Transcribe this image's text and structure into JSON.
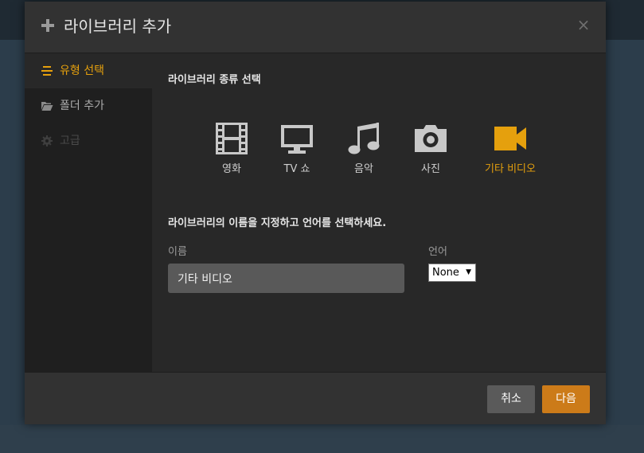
{
  "dialog": {
    "title": "라이브러리 추가",
    "close_symbol": "×"
  },
  "sidebar": {
    "items": [
      {
        "label": "유형 선택",
        "icon": "list-icon",
        "state": "active"
      },
      {
        "label": "폴더 추가",
        "icon": "folder-icon",
        "state": "normal"
      },
      {
        "label": "고급",
        "icon": "gear-icon",
        "state": "disabled"
      }
    ]
  },
  "main": {
    "type_heading": "라이브러리 종류 선택",
    "types": [
      {
        "label": "영화",
        "icon": "film-icon"
      },
      {
        "label": "TV 쇼",
        "icon": "tv-icon"
      },
      {
        "label": "음악",
        "icon": "music-icon"
      },
      {
        "label": "사진",
        "icon": "camera-icon"
      },
      {
        "label": "기타 비디오",
        "icon": "video-camera-icon",
        "selected": true
      }
    ],
    "name_instruction": "라이브러리의 이름을 지정하고 언어를 선택하세요.",
    "name_label": "이름",
    "name_value": "기타 비디오",
    "language_label": "언어",
    "language_value": "None"
  },
  "footer": {
    "cancel_label": "취소",
    "next_label": "다음"
  },
  "colors": {
    "accent": "#e5a00d",
    "next_button": "#cc7b19",
    "cancel_button": "#5a5a5a"
  }
}
